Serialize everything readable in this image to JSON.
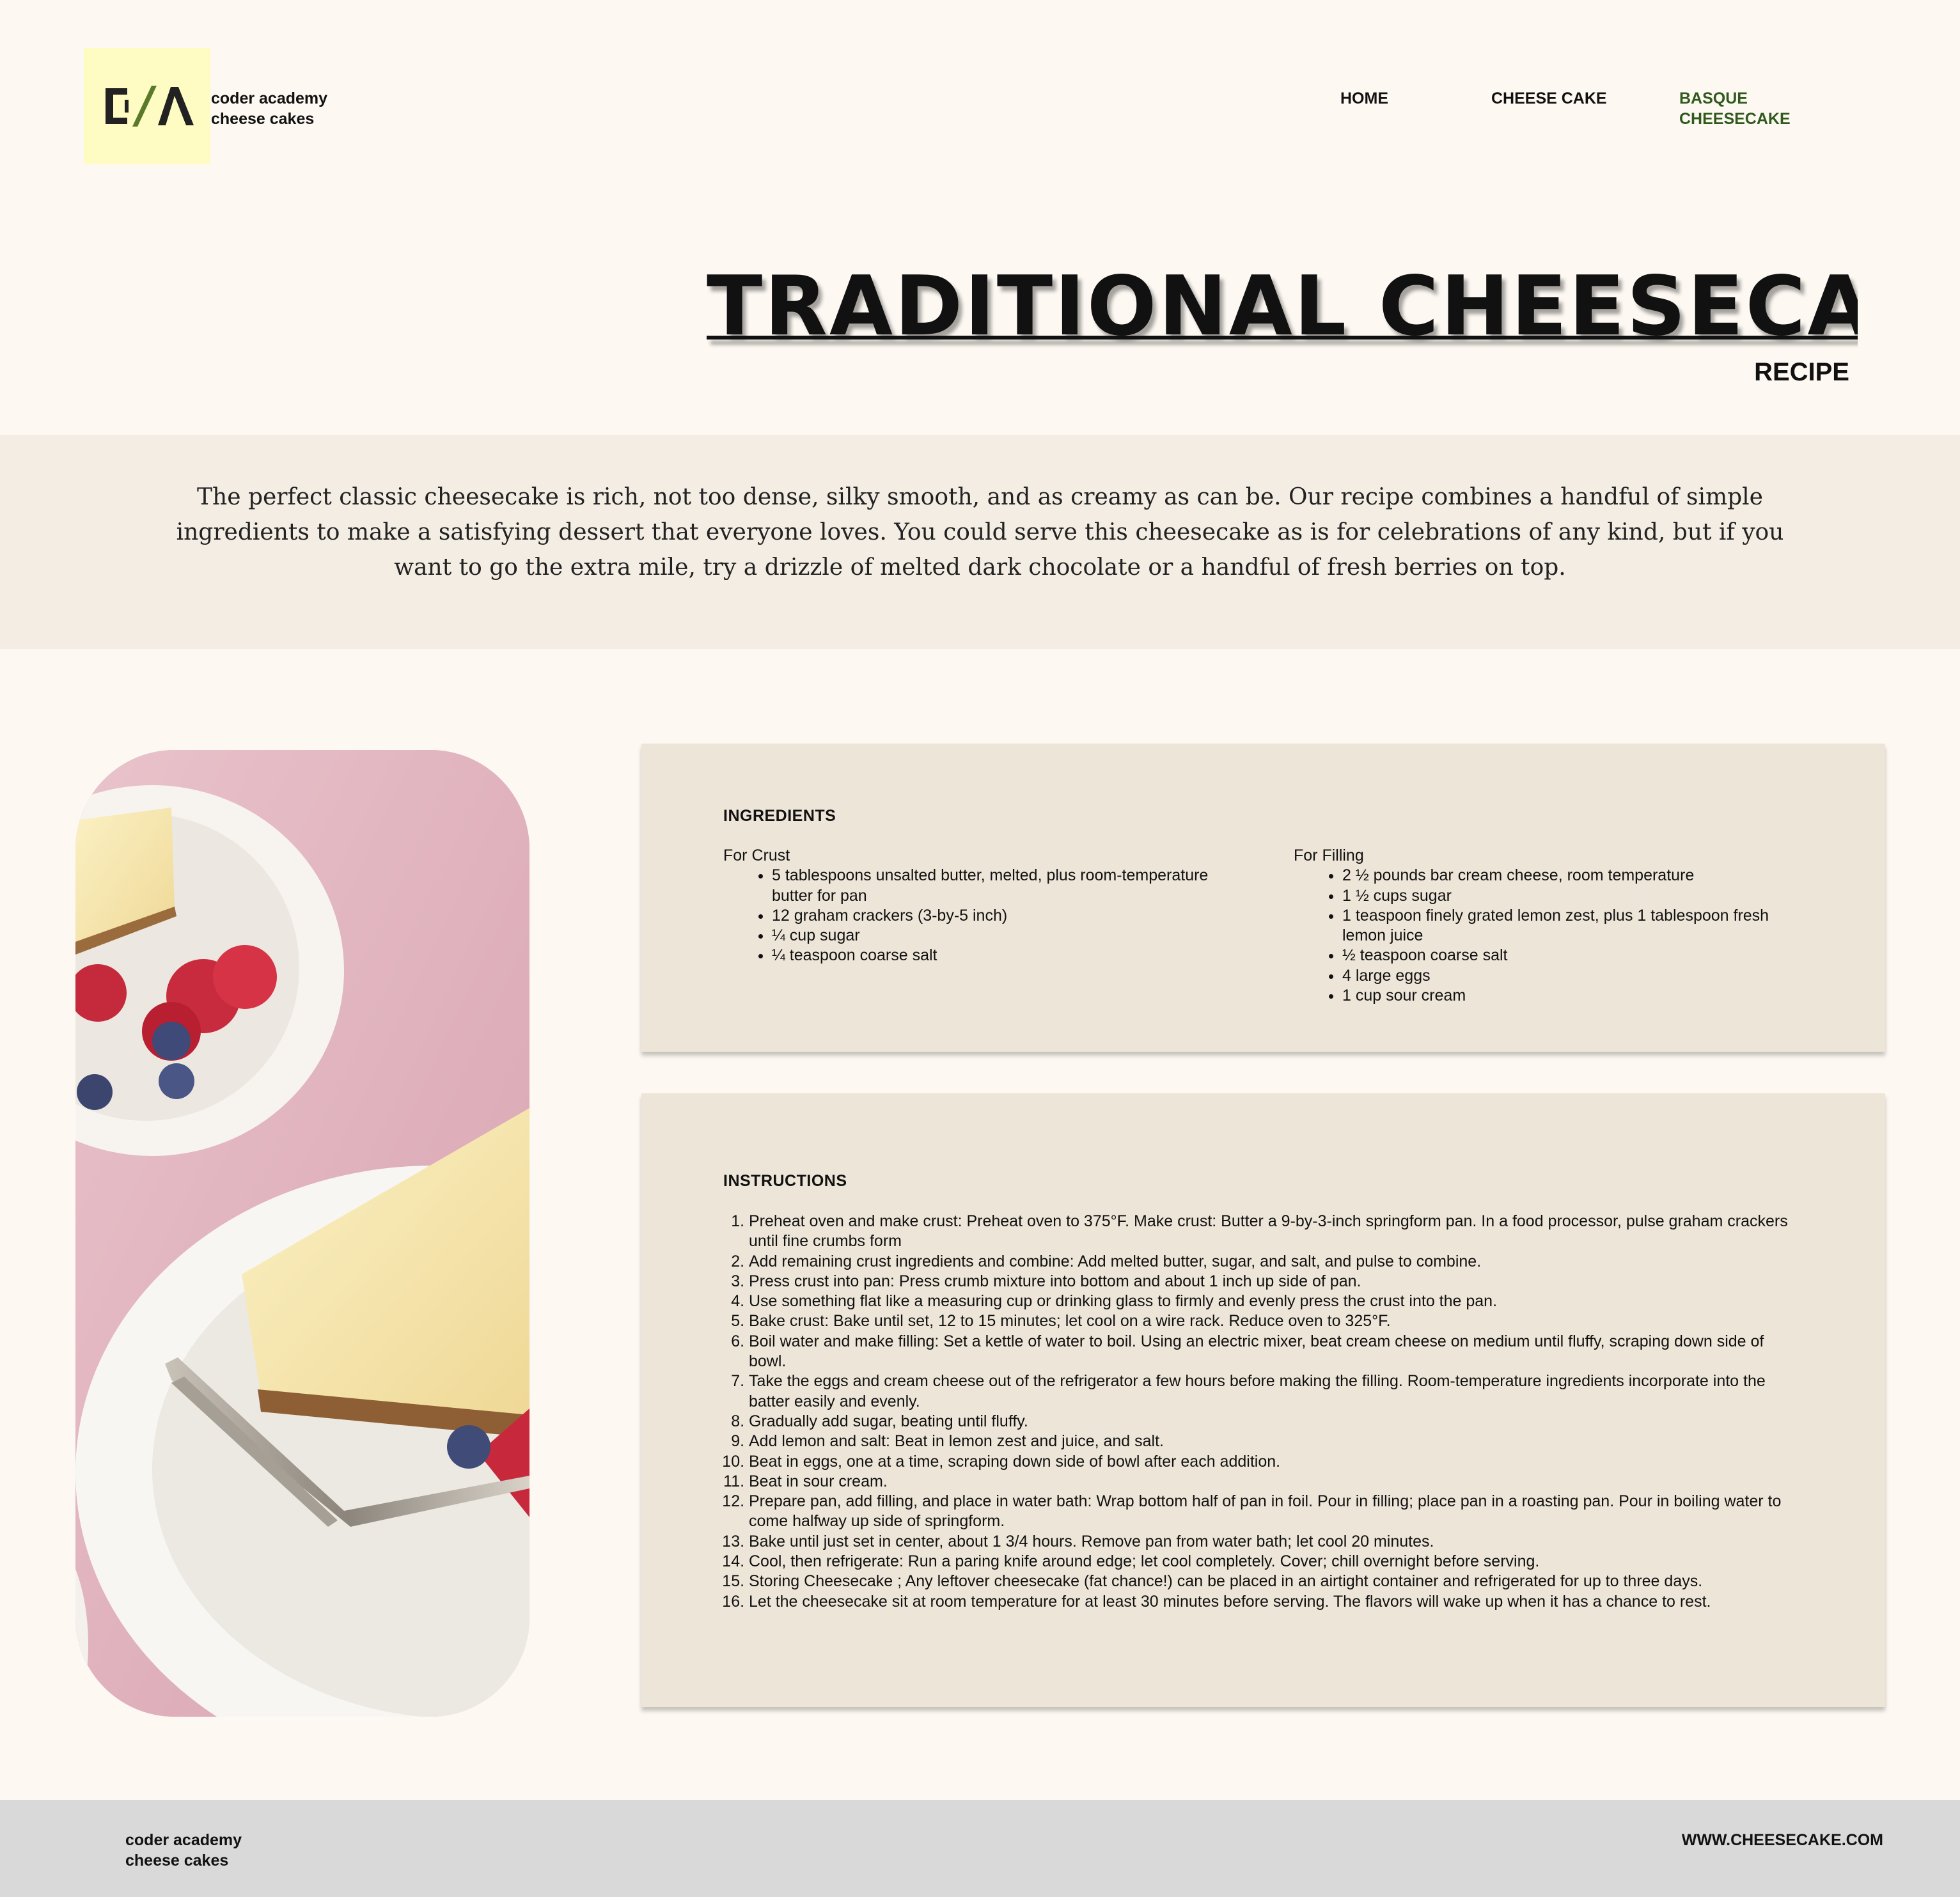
{
  "header": {
    "logo_text": "C/\\",
    "brand_line1": "coder academy",
    "brand_line2": "cheese cakes",
    "nav": [
      {
        "label": "HOME"
      },
      {
        "label": "CHEESE CAKE"
      },
      {
        "label": "BASQUE CHEESECAKE",
        "active": true
      }
    ],
    "accent_color": "#2f5a1c",
    "logo_bg": "#fefcc2"
  },
  "hero": {
    "title": "TRADITIONAL CHEESECAKE",
    "subtitle": "RECIPE"
  },
  "intro": {
    "text": "The perfect classic cheesecake is rich, not too dense, silky smooth, and as creamy as can be. Our recipe combines a handful of simple ingredients to make a satisfying dessert that everyone loves. You could serve this cheesecake as is for celebrations of any kind, but if you want to go the extra mile, try a drizzle of melted dark chocolate or a handful of fresh berries on top."
  },
  "ingredients": {
    "heading": "INGREDIENTS",
    "crust": {
      "label": "For Crust",
      "items": [
        "5 tablespoons unsalted butter, melted, plus room-temperature butter for pan",
        "12 graham crackers (3-by-5 inch)",
        "¼ cup sugar",
        "¼ teaspoon coarse salt"
      ]
    },
    "filling": {
      "label": "For Filling",
      "items": [
        "2 ½ pounds bar cream cheese, room temperature",
        "1 ½ cups sugar",
        "1 teaspoon finely grated lemon zest, plus 1 tablespoon fresh lemon juice",
        "½ teaspoon coarse salt",
        "4 large eggs",
        "1 cup sour cream"
      ]
    }
  },
  "instructions": {
    "heading": "INSTRUCTIONS",
    "steps": [
      "Preheat oven and make crust: Preheat oven to 375°F. Make crust: Butter a 9-by-3-inch springform pan. In a food processor, pulse graham crackers until fine crumbs form",
      "Add remaining crust ingredients and combine: Add melted butter, sugar, and salt, and pulse to combine.",
      "Press crust into pan: Press crumb mixture into bottom and about 1 inch up side of pan.",
      "Use something flat like a measuring cup or drinking glass to firmly and evenly press the crust into the pan.",
      "Bake crust: Bake until set, 12 to 15 minutes; let cool on a wire rack. Reduce oven to 325°F.",
      "Boil water and make filling: Set a kettle of water to boil. Using an electric mixer, beat cream cheese on medium until fluffy, scraping down side of bowl.",
      "Take the eggs and cream cheese out of the refrigerator a few hours before making the filling. Room-temperature ingredients incorporate into the batter easily and evenly.",
      "Gradually add sugar, beating until fluffy.",
      "Add lemon and salt: Beat in lemon zest and juice, and salt.",
      "Beat in eggs, one at a time, scraping down side of bowl after each addition.",
      "Beat in sour cream.",
      "Prepare pan, add filling, and place in water bath: Wrap bottom half of pan in foil. Pour in filling; place pan in a roasting pan. Pour in boiling water to come halfway up side of springform.",
      "Bake until just set in center, about 1 3/4 hours. Remove pan from water bath; let cool 20 minutes.",
      "Cool, then refrigerate: Run a paring knife around edge; let cool completely. Cover; chill overnight before serving.",
      "Storing Cheesecake ; Any leftover cheesecake (fat chance!) can be placed in an airtight container and refrigerated for up to three days.",
      "Let the cheesecake sit at room temperature for at least 30 minutes before serving. The flavors will wake up when it has a chance to rest."
    ]
  },
  "footer": {
    "brand_line1": "coder academy",
    "brand_line2": "cheese cakes",
    "url": "WWW.CHEESECAKE.COM"
  }
}
